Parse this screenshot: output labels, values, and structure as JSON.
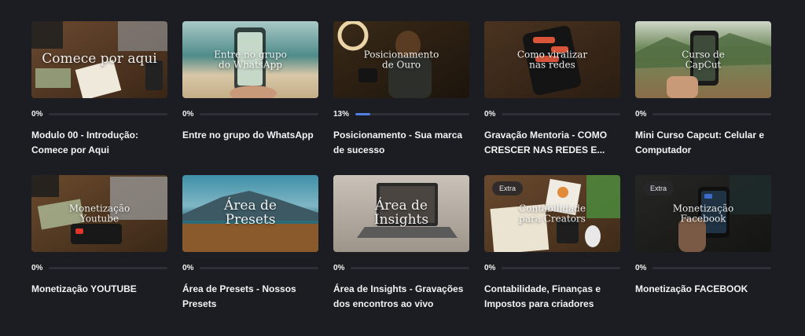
{
  "modules": [
    {
      "thumb_title": "Comece por aqui",
      "title": "Modulo 00 - Introdução: Comece por Aqui",
      "progress_text": "0%",
      "progress": 0,
      "badge": ""
    },
    {
      "thumb_title": "Entre no grupo\ndo WhatsApp",
      "title": "Entre no grupo do WhatsApp",
      "progress_text": "0%",
      "progress": 0,
      "badge": ""
    },
    {
      "thumb_title": "Posicionamento\nde Ouro",
      "title": "Posicionamento - Sua marca de sucesso",
      "progress_text": "13%",
      "progress": 0.13,
      "badge": ""
    },
    {
      "thumb_title": "Como viralizar\nnas redes",
      "title": "Gravação Mentoria - COMO CRESCER NAS REDES E...",
      "progress_text": "0%",
      "progress": 0,
      "badge": ""
    },
    {
      "thumb_title": "Curso de\nCapCut",
      "title": "Mini Curso Capcut: Celular e Computador",
      "progress_text": "0%",
      "progress": 0,
      "badge": ""
    },
    {
      "thumb_title": "Monetização\nYoutube",
      "title": "Monetização YOUTUBE",
      "progress_text": "0%",
      "progress": 0,
      "badge": ""
    },
    {
      "thumb_title": "Área de\nPresets",
      "title": "Área de Presets - Nossos Presets",
      "progress_text": "0%",
      "progress": 0,
      "badge": ""
    },
    {
      "thumb_title": "Área de\nInsights",
      "title": "Área de Insights - Gravações dos encontros ao vivo",
      "progress_text": "0%",
      "progress": 0,
      "badge": ""
    },
    {
      "thumb_title": "Contabilidade\npara Creators",
      "title": "Contabilidade, Finanças e Impostos para criadores",
      "progress_text": "0%",
      "progress": 0,
      "badge": "Extra"
    },
    {
      "thumb_title": "Monetização\nFacebook",
      "title": "Monetização FACEBOOK",
      "progress_text": "0%",
      "progress": 0,
      "badge": "Extra"
    }
  ],
  "colors": {
    "background": "#1c1d22",
    "progress_fill": "#4f7fe0",
    "progress_track": "#2e3038"
  }
}
